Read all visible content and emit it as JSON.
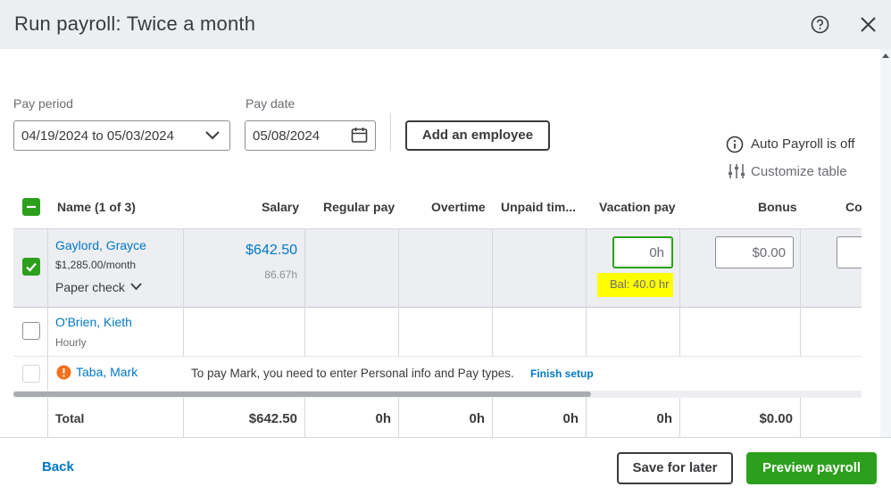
{
  "header": {
    "title": "Run payroll: Twice a month",
    "help_icon": "help-circle-icon",
    "close_icon": "close-icon"
  },
  "pay_period": {
    "label": "Pay period",
    "value": "04/19/2024 to 05/03/2024"
  },
  "pay_date": {
    "label": "Pay date",
    "value": "05/08/2024"
  },
  "add_employee_label": "Add an employee",
  "auto_payroll": {
    "label": "Auto Payroll is off",
    "icon": "info-circle-icon"
  },
  "customize": {
    "label": "Customize table",
    "icon": "sliders-icon"
  },
  "table": {
    "headers": {
      "name": "Name (1 of 3)",
      "salary": "Salary",
      "regular_pay": "Regular pay",
      "overtime": "Overtime",
      "unpaid_time": "Unpaid tim...",
      "vacation_pay": "Vacation pay",
      "bonus": "Bonus",
      "co": "Co"
    },
    "rows": [
      {
        "name": "Gaylord, Grayce",
        "rate": "$1,285.00/month",
        "payment_method": "Paper check",
        "salary": "$642.50",
        "hours": "86.67h",
        "vacation_input": "0h",
        "vacation_balance": "Bal: 40.0 hr",
        "bonus_input": "$0.00",
        "checked": true
      },
      {
        "name": "O'Brien, Kieth",
        "rate": "Hourly",
        "checked": false
      },
      {
        "name": "Taba, Mark",
        "warning": "To pay Mark, you need to enter Personal info and Pay types.",
        "finish_setup": "Finish setup",
        "checked": false
      }
    ],
    "total": {
      "label": "Total",
      "salary": "$642.50",
      "regular_pay": "0h",
      "overtime": "0h",
      "unpaid_time": "0h",
      "vacation_pay": "0h",
      "bonus": "$0.00"
    }
  },
  "footer": {
    "back": "Back",
    "save_for_later": "Save for later",
    "preview": "Preview payroll"
  },
  "colors": {
    "accent": "#2ca01c",
    "link": "#0077c5",
    "highlight": "#ffff00",
    "warning": "#f2711c"
  }
}
